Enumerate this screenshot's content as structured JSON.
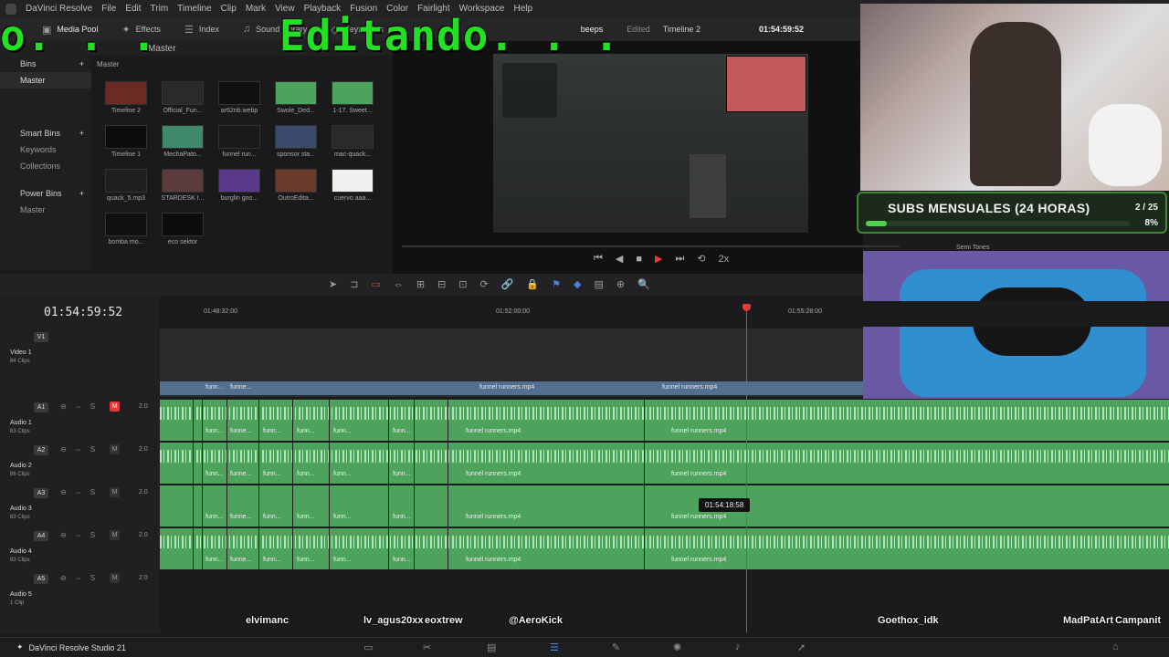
{
  "menu": {
    "app": "DaVinci Resolve",
    "items": [
      "File",
      "Edit",
      "Trim",
      "Timeline",
      "Clip",
      "Mark",
      "View",
      "Playback",
      "Fusion",
      "Color",
      "Fairlight",
      "Workspace",
      "Help"
    ]
  },
  "toolbar": {
    "media_pool": "Media Pool",
    "effects": "Effects",
    "index": "Index",
    "sound_library": "Sound Library",
    "keyframes": "Keyframes",
    "project_title": "beeps",
    "edited": "Edited",
    "timeline_name": "Timeline 2",
    "viewer_tc": "01:54:59:52"
  },
  "overlay": {
    "left_text": "o. . .",
    "big_text": "Editando. . ."
  },
  "media_pool": {
    "header": "Master",
    "crumb": "Master",
    "bins_label": "Bins",
    "master_bin": "Master",
    "smart_bins": "Smart Bins",
    "keywords": "Keywords",
    "collections": "Collections",
    "power_bins": "Power Bins",
    "power_master": "Master",
    "clips": [
      {
        "name": "Timeline 2",
        "color": "#6b2a24"
      },
      {
        "name": "Official_Fun...",
        "color": "#2a2a2a"
      },
      {
        "name": "ar62nb.webp",
        "color": "#111111"
      },
      {
        "name": "Swole_Ded...",
        "color": "#4ea35c"
      },
      {
        "name": "1-17. Sweet...",
        "color": "#4ea35c"
      },
      {
        "name": "Timeline 1",
        "color": "#0c0c0c"
      },
      {
        "name": "MechaPato...",
        "color": "#3f8a6a"
      },
      {
        "name": "funnel run...",
        "color": "#1a1a1a"
      },
      {
        "name": "sponsor sta...",
        "color": "#3a4a6a"
      },
      {
        "name": "mac-quack...",
        "color": "#2a2a2a"
      },
      {
        "name": "quack_5.mp3",
        "color": "#1f1f1f"
      },
      {
        "name": "STARDESK I...",
        "color": "#5a3a3a"
      },
      {
        "name": "burglin gno...",
        "color": "#5a3a8a"
      },
      {
        "name": "OutroEdita...",
        "color": "#6a3a2a"
      },
      {
        "name": "cuervo aaa...",
        "color": "#f0f0f0"
      },
      {
        "name": "bomba mo...",
        "color": "#101010"
      },
      {
        "name": "eco sektor",
        "color": "#0c0c0c"
      }
    ]
  },
  "overlays": {
    "subs_title": "SUBS MENSUALES (24 HORAS)",
    "subs_count": "2 / 25",
    "subs_pct": "8%",
    "subs_fraction": 0.08,
    "semi_tones": "Semi Tones"
  },
  "transport": {
    "speed": "2x"
  },
  "timeline": {
    "timecode": "01:54:59:52",
    "ruler": [
      "01:48:32:00",
      "01:52:00:00",
      "01:55:28:00"
    ],
    "tooltip_tc": "01:54:18:58",
    "video_track": {
      "badge": "V1",
      "name": "Video 1",
      "clips": "84 Clips"
    },
    "audio_tracks": [
      {
        "badge": "A1",
        "name": "Audio 1",
        "clips": "83 Clips",
        "vol": "2.0",
        "m": "M"
      },
      {
        "badge": "A2",
        "name": "Audio 2",
        "clips": "86 Clips",
        "vol": "2.0",
        "m": "M"
      },
      {
        "badge": "A3",
        "name": "Audio 3",
        "clips": "83 Clips",
        "vol": "2.0",
        "m": "M"
      },
      {
        "badge": "A4",
        "name": "Audio 4",
        "clips": "83 Clips",
        "vol": "2.0",
        "m": "M"
      },
      {
        "badge": "A5",
        "name": "Audio 5",
        "clips": "1 Clip",
        "vol": "2.0",
        "m": "M"
      }
    ],
    "clip_short": "funn...",
    "clip_short_b": "funne...",
    "clip_full": "funnel runners.mp4"
  },
  "chat": [
    "elvimanc",
    "lv_agus20xx",
    "eoxtrew",
    "@AeroKick",
    "Goethox_idk",
    "MadPatArt",
    "Campanit"
  ],
  "footer": {
    "brand": "DaVinci Resolve Studio 21"
  }
}
